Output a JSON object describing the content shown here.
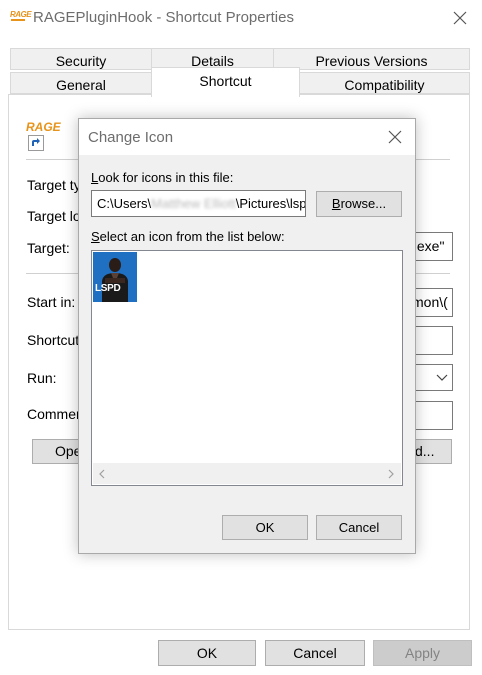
{
  "window": {
    "title": "RAGEPluginHook - Shortcut Properties",
    "app_icon_text": "RAGE"
  },
  "tabs": {
    "row1": [
      "Security",
      "Details",
      "Previous Versions"
    ],
    "row2": [
      "General",
      "Shortcut",
      "Compatibility"
    ],
    "active": "Shortcut"
  },
  "shortcut": {
    "icon_text": "RAGE",
    "target_type_label": "Target ty",
    "target_location_label": "Target lo",
    "target_label": "Target:",
    "target_value": "k.exe\"",
    "start_in_label": "Start in:",
    "start_in_value": "mon\\(",
    "shortcut_key_label": "Shortcut",
    "run_label": "Run:",
    "comment_label": "Commen",
    "open_file_location_label": "Ope",
    "advanced_label": "d..."
  },
  "footer": {
    "ok": "OK",
    "cancel": "Cancel",
    "apply": "Apply"
  },
  "change_icon": {
    "title": "Change Icon",
    "look_label_first": "L",
    "look_label_rest": "ook for icons in this file:",
    "path_start": "C:\\Users\\",
    "path_blurred": "Matthew Elliott",
    "path_end": "\\Pictures\\lsp",
    "browse_first": "B",
    "browse_rest": "rowse...",
    "select_label_first": "S",
    "select_label_rest": "elect an icon from the list below:",
    "icon_item_text": "LSPD",
    "ok": "OK",
    "cancel": "Cancel"
  },
  "colors": {
    "apply_disabled_bg": "#cccccc",
    "apply_disabled_text": "#838383",
    "icon_tile_bg": "#1f6fc2",
    "rage_orange": "#e8931a"
  }
}
